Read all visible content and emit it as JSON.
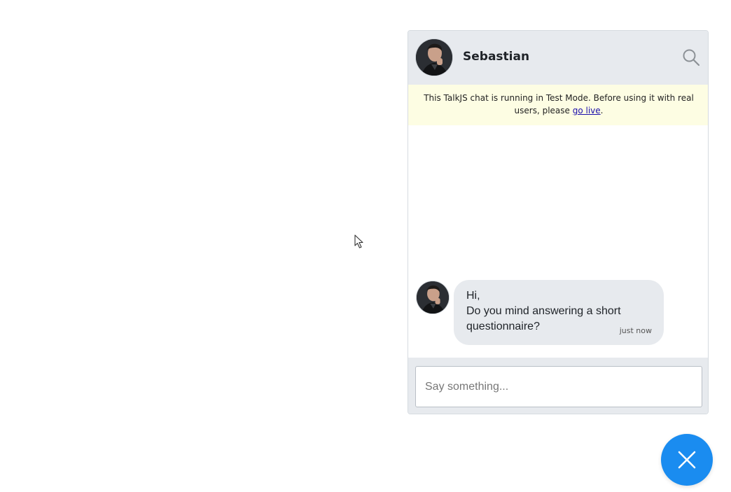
{
  "chat": {
    "header": {
      "name": "Sebastian",
      "avatar_icon": "user-avatar",
      "search_icon": "search-icon"
    },
    "test_banner": {
      "text_before": "This TalkJS chat is running in Test Mode. Before using it with real users, please ",
      "link_text": "go live",
      "text_after": "."
    },
    "messages": [
      {
        "sender": "Sebastian",
        "lines": [
          "Hi,",
          "Do you mind answering a short",
          "questionnaire?"
        ],
        "time": "just now"
      }
    ],
    "composer": {
      "placeholder": "Say something..."
    }
  },
  "launcher": {
    "icon": "close-icon",
    "color": "#1a8cf0"
  },
  "colors": {
    "header_bg": "#e7eaee",
    "banner_bg": "#fdfde3",
    "bubble_bg": "#e7eaee",
    "link": "#1a0dab"
  }
}
